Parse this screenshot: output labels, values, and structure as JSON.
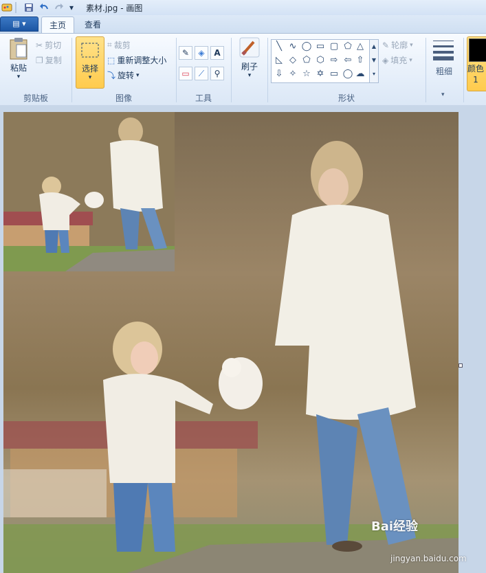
{
  "window": {
    "title": "素材.jpg - 画图",
    "quick_access": [
      "save-icon",
      "undo-icon",
      "redo-icon",
      "customize-icon"
    ]
  },
  "tabs": {
    "file_label": "▤ ▾",
    "items": [
      {
        "label": "主页",
        "active": true
      },
      {
        "label": "查看",
        "active": false
      }
    ]
  },
  "ribbon": {
    "clipboard": {
      "label": "剪贴板",
      "paste": "粘贴",
      "cut": "剪切",
      "copy": "复制"
    },
    "image": {
      "label": "图像",
      "select": "选择",
      "crop": "裁剪",
      "resize": "重新调整大小",
      "rotate": "旋转"
    },
    "tools": {
      "label": "工具"
    },
    "brushes": {
      "label": "刷子"
    },
    "shapes": {
      "label": "形状",
      "outline": "轮廓",
      "fill": "填充"
    },
    "size": {
      "label": "粗细"
    },
    "colors": {
      "label": "颜色 1"
    }
  },
  "watermark": {
    "brand": "Bai经验",
    "url": "jingyan.baidu.com"
  },
  "colors": {
    "accent": "#3b78c4",
    "color1": "#000000",
    "select_highlight": "#ffcb4d"
  }
}
